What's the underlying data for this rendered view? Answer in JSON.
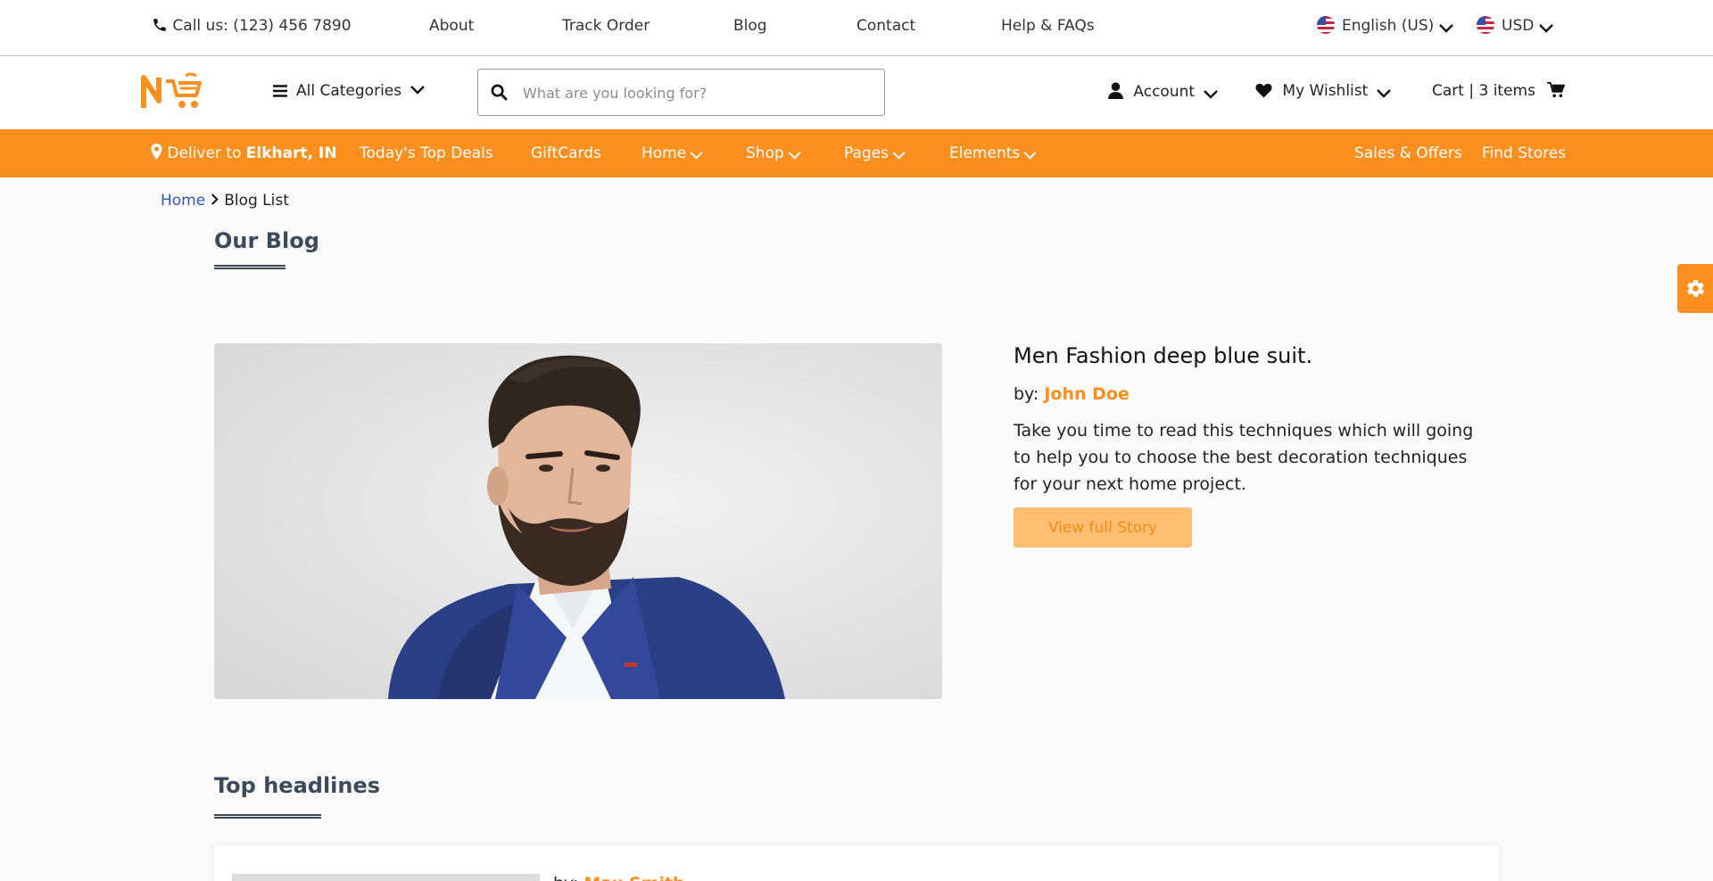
{
  "topbar": {
    "phone": "Call us: (123) 456 7890",
    "links": [
      "About",
      "Track Order",
      "Blog",
      "Contact",
      "Help & FAQs"
    ],
    "language": "English (US)",
    "currency": "USD"
  },
  "header": {
    "all_categories": "All Categories",
    "search_placeholder": "What are you looking for?",
    "account": "Account",
    "wishlist": "My Wishlist",
    "cart": "Cart | 3 items"
  },
  "nav": {
    "deliver_prefix": "Deliver to",
    "deliver_location": "Elkhart, IN",
    "items": [
      "Today's Top Deals",
      "GiftCards",
      "Home",
      "Shop",
      "Pages",
      "Elements"
    ],
    "right": [
      "Sales & Offers",
      "Find Stores"
    ]
  },
  "breadcrumb": {
    "home": "Home",
    "current": "Blog List"
  },
  "blog": {
    "section_title": "Our Blog",
    "featured": {
      "title": "Men Fashion deep blue suit.",
      "by_label": "by:",
      "author": "John Doe",
      "description": "Take you time to read this techniques which will going to help you to choose the best decoration techniques for your next home project.",
      "button": "View full Story"
    }
  },
  "headlines": {
    "section_title": "Top headlines",
    "first": {
      "by_label": "by:",
      "author": "Max Smith"
    }
  },
  "colors": {
    "accent": "#fd8f1f",
    "button_bg": "#ffbe72",
    "link": "#3656b8",
    "heading": "#3c4a5c"
  }
}
